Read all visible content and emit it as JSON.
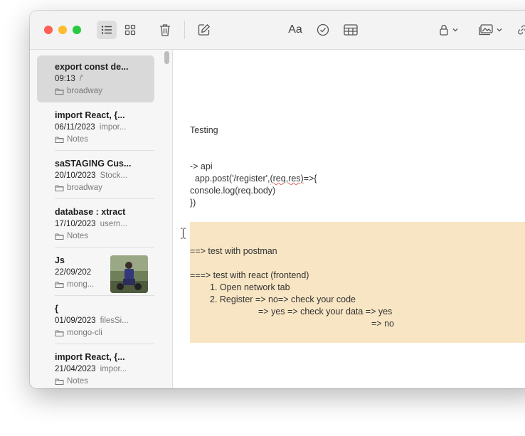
{
  "toolbar": {
    "font_button_label": "Aa"
  },
  "notes": [
    {
      "title": "export const de...",
      "date": "09:13",
      "preview": "/'",
      "folder": "broadway"
    },
    {
      "title": "import React, {...",
      "date": "06/11/2023",
      "preview": "impor...",
      "folder": "Notes"
    },
    {
      "title": "saSTAGING Cus...",
      "date": "20/10/2023",
      "preview": "Stock...",
      "folder": "broadway"
    },
    {
      "title": "database : xtract",
      "date": "17/10/2023",
      "preview": "usern...",
      "folder": "Notes"
    },
    {
      "title": "Js",
      "date": "22/09/202",
      "preview": "",
      "folder": "mong..."
    },
    {
      "title": "{",
      "date": "01/09/2023",
      "preview": "filesSi...",
      "folder": "mongo-cli"
    },
    {
      "title": "import React, {...",
      "date": "21/04/2023",
      "preview": "impor...",
      "folder": "Notes"
    }
  ],
  "editor": {
    "heading": "Testing",
    "api_line": "-> api",
    "post_prefix": "  app.post('/register',",
    "post_args": "(req,res)",
    "post_suffix": "=>{",
    "console_line": "console.log(req.body)",
    "close_line": "})",
    "h1": "==> test with postman",
    "h2": "===> test with react (frontend)",
    "h3": "1. Open network tab",
    "h4": "2. Register => no=> check your code",
    "h5": "=> yes => check your data => yes",
    "h6": "=> no"
  },
  "colors": {
    "highlight": "#f8e5c4",
    "selected_note": "#d9d9d9",
    "close": "#fe5f57",
    "minimize": "#febc2e",
    "zoom": "#28c840"
  }
}
